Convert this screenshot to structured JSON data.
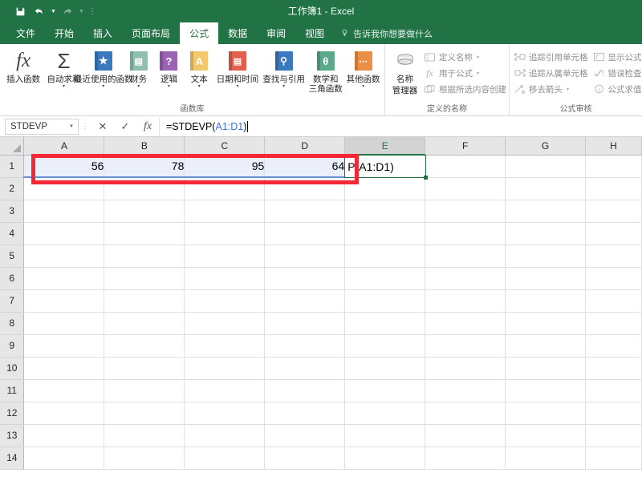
{
  "titlebar": {
    "doc_title": "工作簿1  -  Excel",
    "qat": [
      {
        "name": "save-button",
        "icon": "save-icon",
        "state": "enabled"
      },
      {
        "name": "undo-button",
        "icon": "undo-icon",
        "state": "enabled"
      },
      {
        "name": "redo-button",
        "icon": "redo-icon",
        "state": "disabled"
      },
      {
        "name": "customize-qat-button",
        "icon": "more-icon",
        "state": "enabled"
      }
    ]
  },
  "tabs": [
    {
      "label": "文件",
      "active": false
    },
    {
      "label": "开始",
      "active": false
    },
    {
      "label": "插入",
      "active": false
    },
    {
      "label": "页面布局",
      "active": false
    },
    {
      "label": "公式",
      "active": true
    },
    {
      "label": "数据",
      "active": false
    },
    {
      "label": "审阅",
      "active": false
    },
    {
      "label": "视图",
      "active": false
    }
  ],
  "tellme": {
    "label": "告诉我你想要做什么",
    "icon": "lightbulb-icon"
  },
  "ribbon": {
    "function_library": {
      "group_label": "函数库",
      "insert_function": {
        "label": "插入函数",
        "icon": "fx-icon"
      },
      "autosum": {
        "label": "自动求和",
        "icon": "sigma-icon",
        "dropdown": "▾"
      },
      "buttons": [
        {
          "label": "最近使用的函数",
          "icon": "star-book-icon",
          "color": "#3a79bd",
          "glyph": "★",
          "dropdown": "▾"
        },
        {
          "label": "财务",
          "icon": "financial-book-icon",
          "color": "#61a48f",
          "glyph": "▤",
          "dropdown": "▾"
        },
        {
          "label": "逻辑",
          "icon": "logical-book-icon",
          "color": "#8e5ea8",
          "glyph": "?",
          "dropdown": "▾"
        },
        {
          "label": "文本",
          "icon": "text-book-icon",
          "color": "#f1c366",
          "glyph": "A",
          "dropdown": "▾"
        },
        {
          "label": "日期和时间",
          "icon": "date-time-book-icon",
          "color": "#e05a42",
          "glyph": "▤",
          "dropdown": "▾"
        },
        {
          "label": "查找与引用",
          "icon": "lookup-book-icon",
          "color": "#3a79bd",
          "glyph": "⌕",
          "dropdown": "▾"
        },
        {
          "label": "数学和\n三角函数",
          "icon": "math-trig-book-icon",
          "color": "#4f9d7e",
          "glyph": "θ",
          "dropdown": "▾"
        },
        {
          "label": "其他函数",
          "icon": "more-functions-book-icon",
          "color": "#e8893c",
          "glyph": "⋯",
          "dropdown": "▾"
        }
      ]
    },
    "defined_names": {
      "group_label": "定义的名称",
      "name_manager": {
        "label_line1": "名称",
        "label_line2": "管理器",
        "icon": "name-manager-icon"
      },
      "items": [
        {
          "label": "定义名称",
          "icon": "define-name-icon",
          "dropdown": "▾"
        },
        {
          "label": "用于公式",
          "icon": "use-in-formula-icon",
          "dropdown": "▾"
        },
        {
          "label": "根据所选内容创建",
          "icon": "create-from-selection-icon",
          "dropdown": ""
        }
      ]
    },
    "formula_auditing": {
      "group_label": "公式审核",
      "col1": [
        {
          "label": "追踪引用单元格",
          "icon": "trace-precedents-icon",
          "dropdown": ""
        },
        {
          "label": "追踪从属单元格",
          "icon": "trace-dependents-icon",
          "dropdown": ""
        },
        {
          "label": "移去箭头",
          "icon": "remove-arrows-icon",
          "dropdown": "▾"
        }
      ],
      "col2": [
        {
          "label": "显示公式",
          "icon": "show-formulas-icon",
          "dropdown": ""
        },
        {
          "label": "错误检查",
          "icon": "error-checking-icon",
          "dropdown": ""
        },
        {
          "label": "公式求值",
          "icon": "evaluate-formula-icon",
          "dropdown": ""
        }
      ]
    }
  },
  "formula_bar": {
    "name_box_value": "STDEVP",
    "cancel_icon": "cancel-icon",
    "confirm_icon": "confirm-icon",
    "insert_function_icon": "fx-icon",
    "formula_prefix": "=STDEVP(",
    "formula_reference": "A1:D1",
    "formula_suffix": ")"
  },
  "grid": {
    "columns": [
      "A",
      "B",
      "C",
      "D",
      "E",
      "F",
      "G",
      "H"
    ],
    "selected_column": "E",
    "rows": [
      "1",
      "2",
      "3",
      "4",
      "5",
      "6",
      "7",
      "8",
      "9",
      "10",
      "11",
      "12",
      "13",
      "14"
    ],
    "row1_values": {
      "A": "56",
      "B": "78",
      "C": "95",
      "D": "64"
    },
    "editing_cell": {
      "address": "E1",
      "visible_text": "P(A1:D1)"
    },
    "reference_highlight_range": "A1:D1",
    "annotation": {
      "name": "red-highlight-rectangle",
      "color": "#f32735",
      "covers": "A1:D1"
    }
  }
}
